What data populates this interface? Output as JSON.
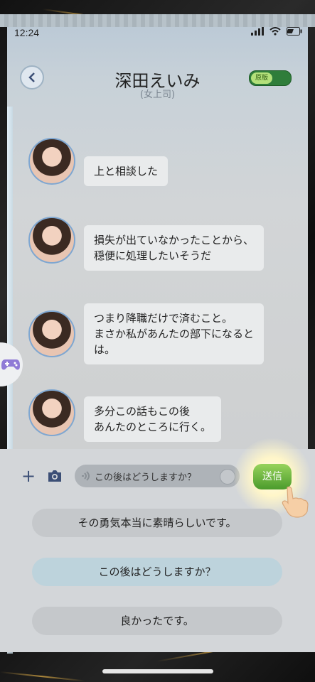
{
  "status_bar": {
    "time": "12:24"
  },
  "header": {
    "title": "深田えいみ",
    "subtitle": "(女上司)",
    "toggle_label": "原版"
  },
  "messages": [
    {
      "text": "上と相談した"
    },
    {
      "text": "損失が出ていなかったことから、\n穏便に処理したいそうだ"
    },
    {
      "text": "つまり降職だけで済むこと。\nまさか私があんたの部下になると\nは。"
    },
    {
      "text": "多分この話もこの後\nあんたのところに行く。"
    }
  ],
  "composer": {
    "input_value": "この後はどうしますか？",
    "send_label": "送信"
  },
  "options": [
    {
      "label": "その勇気本当に素晴らしいです。"
    },
    {
      "label": "この後はどうしますか？"
    },
    {
      "label": "良かったです。"
    }
  ],
  "colors": {
    "send_green": "#5aab32",
    "accent_blue": "#3c4f76"
  }
}
